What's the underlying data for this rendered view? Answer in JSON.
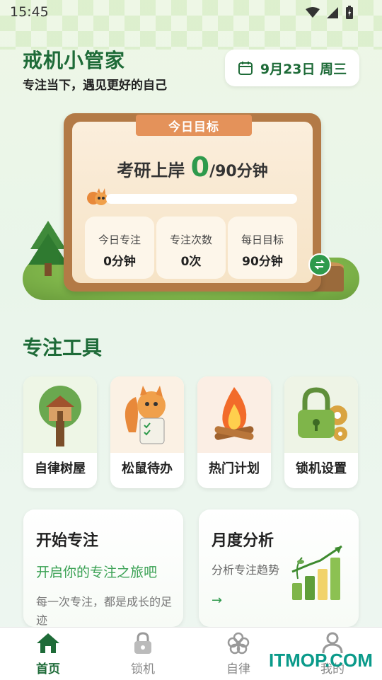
{
  "status": {
    "time": "15:45"
  },
  "header": {
    "title": "戒机小管家",
    "subtitle": "专注当下，遇见更好的自己",
    "date": "9月23日 周三"
  },
  "goal": {
    "ribbon": "今日目标",
    "name": "考研上岸",
    "current": "0",
    "target": "/90分钟",
    "progress_fraction": 0,
    "stats": [
      {
        "label": "今日专注",
        "value": "0分钟"
      },
      {
        "label": "专注次数",
        "value": "0次"
      },
      {
        "label": "每日目标",
        "value": "90分钟"
      }
    ]
  },
  "tools": {
    "title": "专注工具",
    "items": [
      {
        "label": "自律树屋"
      },
      {
        "label": "松鼠待办"
      },
      {
        "label": "热门计划"
      },
      {
        "label": "锁机设置"
      }
    ]
  },
  "focus_card": {
    "title": "开始专注",
    "subtitle": "开启你的专注之旅吧",
    "desc": "每一次专注，都是成长的足迹"
  },
  "analysis_card": {
    "title": "月度分析",
    "subtitle": "分析专注趋势",
    "arrow": "→"
  },
  "nav": {
    "items": [
      {
        "label": "首页"
      },
      {
        "label": "锁机"
      },
      {
        "label": "自律"
      },
      {
        "label": "我的"
      }
    ]
  },
  "watermark": "ITMOP.COM",
  "colors": {
    "brand": "#1e6b38",
    "accent": "#2e9a4c",
    "wood": "#e4925a"
  }
}
